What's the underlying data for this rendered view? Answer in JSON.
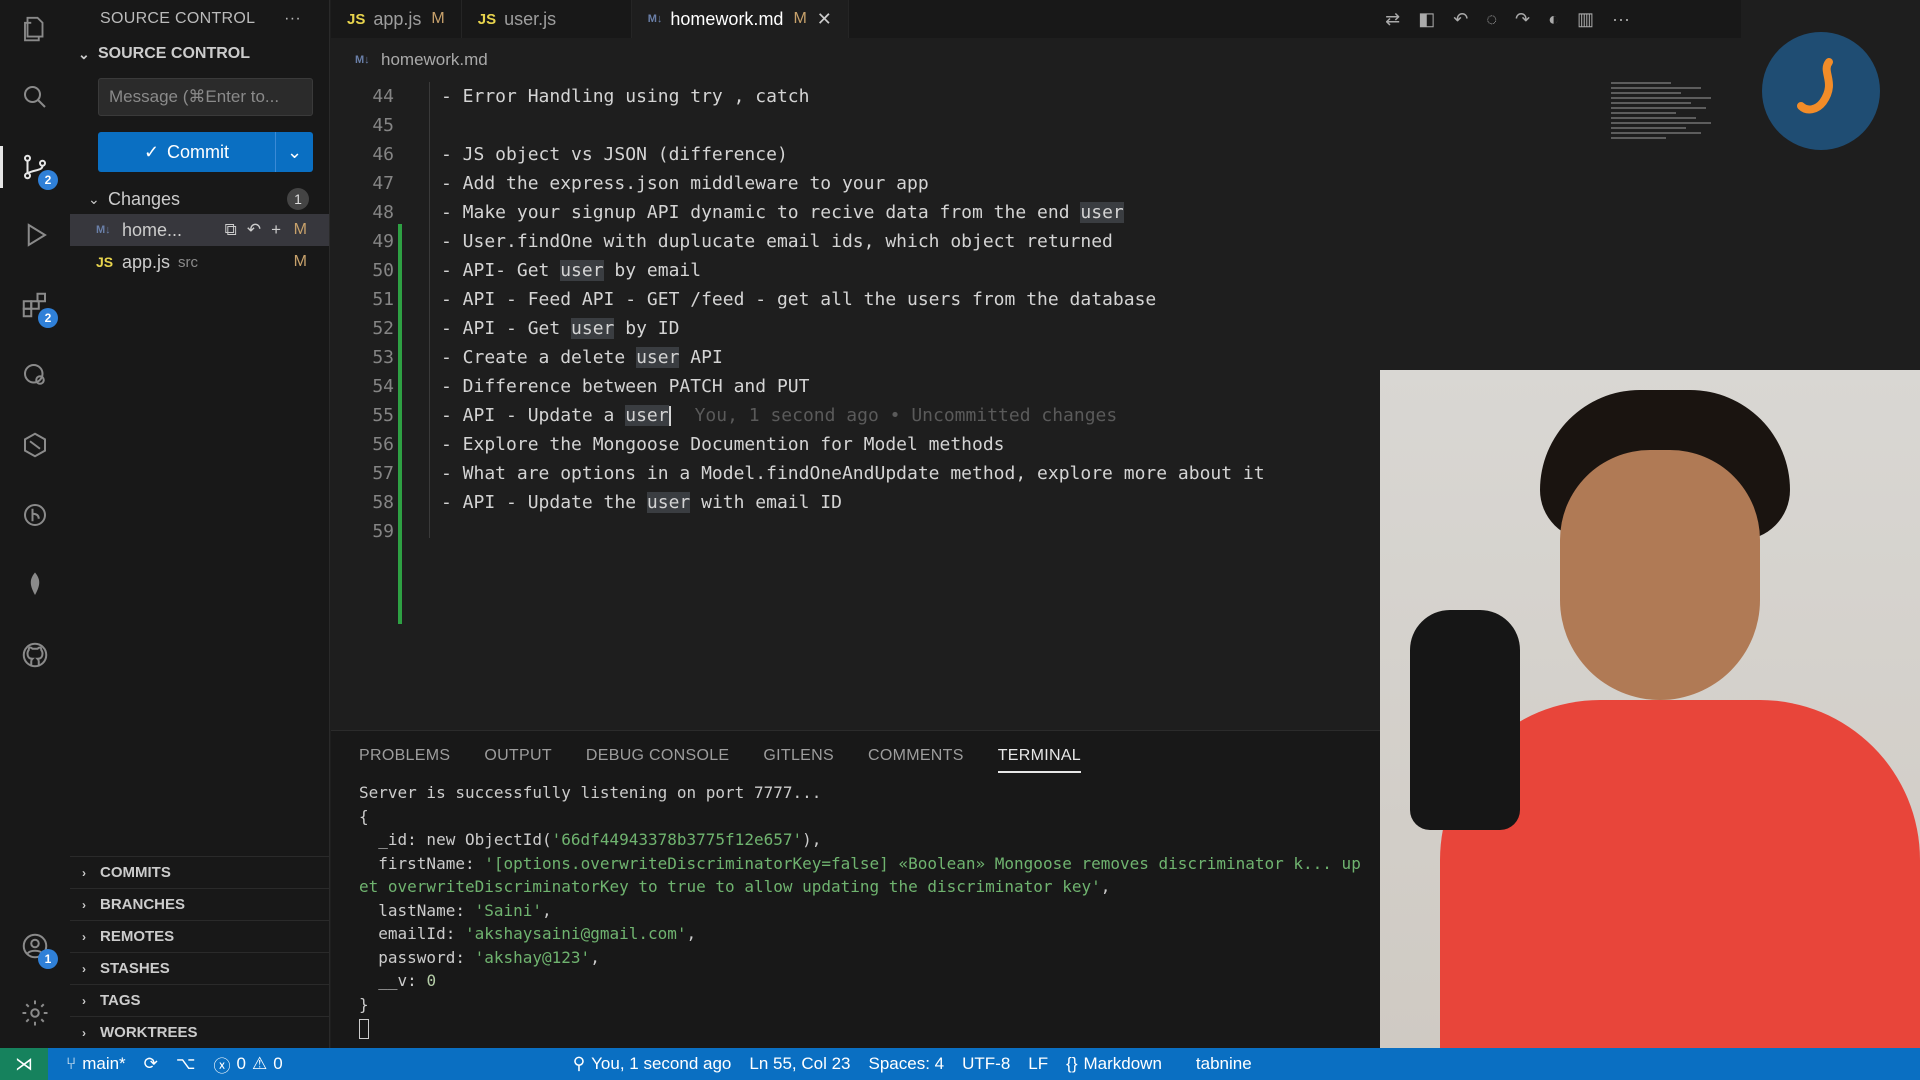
{
  "sidebar": {
    "title": "SOURCE CONTROL",
    "section": "SOURCE CONTROL",
    "message_placeholder": "Message (⌘Enter to...",
    "commit_label": "Commit",
    "changes_label": "Changes",
    "changes_count": "1",
    "files": [
      {
        "name": "home...",
        "dir": "",
        "status": "M"
      },
      {
        "name": "app.js",
        "dir": "src",
        "status": "M"
      }
    ],
    "collapsed": [
      "COMMITS",
      "BRANCHES",
      "REMOTES",
      "STASHES",
      "TAGS",
      "WORKTREES"
    ]
  },
  "activity": {
    "scm_badge": "2",
    "ext_badge": "2",
    "account_badge": "1"
  },
  "tabs": [
    {
      "icon": "JS",
      "label": "app.js",
      "status": "M"
    },
    {
      "icon": "JS",
      "label": "user.js",
      "status": ""
    },
    {
      "icon": "M↓",
      "label": "homework.md",
      "status": "M"
    }
  ],
  "breadcrumb": "homework.md",
  "editor": {
    "lines": [
      {
        "n": "44",
        "text": "- Error Handling using try , catch"
      },
      {
        "n": "45",
        "text": ""
      },
      {
        "n": "46",
        "text": "- JS object vs JSON (difference)"
      },
      {
        "n": "47",
        "text": "- Add the express.json middleware to your app"
      },
      {
        "n": "48",
        "pre": "- Make your signup API dynamic to recive data from the end ",
        "hl": "user",
        "post": ""
      },
      {
        "n": "49",
        "text": "- User.findOne with duplucate email ids, which object returned"
      },
      {
        "n": "50",
        "pre": "- API- Get ",
        "hl": "user",
        "post": " by email"
      },
      {
        "n": "51",
        "text": "- API - Feed API - GET /feed - get all the users from the database"
      },
      {
        "n": "52",
        "pre": "- API - Get ",
        "hl": "user",
        "post": " by ID"
      },
      {
        "n": "53",
        "pre": "- Create a delete ",
        "hl": "user",
        "post": " API"
      },
      {
        "n": "54",
        "text": "- Difference between PATCH and PUT"
      },
      {
        "n": "55",
        "pre": "- API - Update a ",
        "hl": "user",
        "post": ""
      },
      {
        "n": "56",
        "text": "- Explore the Mongoose Documention for Model methods"
      },
      {
        "n": "57",
        "text": "- What are options in a Model.findOneAndUpdate method, explore more about it"
      },
      {
        "n": "58",
        "pre": "- API - Update the ",
        "hl": "user",
        "post": " with email ID"
      },
      {
        "n": "59",
        "text": ""
      }
    ],
    "ghost_text": "You, 1 second ago • Uncommitted changes"
  },
  "panel": {
    "tabs": [
      "PROBLEMS",
      "OUTPUT",
      "DEBUG CONSOLE",
      "GITLENS",
      "COMMENTS",
      "TERMINAL"
    ],
    "active_tab": "TERMINAL",
    "terminal": {
      "l1": "Server is successfully listening on port 7777...",
      "l2": "{",
      "l3a": "  _id: new ObjectId(",
      "l3b": "'66df44943378b3775f12e657'",
      "l3c": "),",
      "l4a": "  firstName: ",
      "l4b": "'[options.overwriteDiscriminatorKey=false] «Boolean» Mongoose removes discriminator k... up",
      "l5": "et overwriteDiscriminatorKey to true to allow updating the discriminator key'",
      "l5c": ",",
      "l6a": "  lastName: ",
      "l6b": "'Saini'",
      "l6c": ",",
      "l7a": "  emailId: ",
      "l7b": "'akshaysaini@gmail.com'",
      "l7c": ",",
      "l8a": "  password: ",
      "l8b": "'akshay@123'",
      "l8c": ",",
      "l9a": "  __v: ",
      "l9b": "0",
      "l10": "}"
    }
  },
  "status": {
    "branch": "main*",
    "errors": "0",
    "warnings": "0",
    "blame": "You, 1 second ago",
    "position": "Ln 55, Col 23",
    "spaces": "Spaces: 4",
    "encoding": "UTF-8",
    "eol": "LF",
    "language": "Markdown",
    "tabnine": "tabnine"
  },
  "colors": {
    "accent": "#0a6fc2",
    "modified": "#c7a16b",
    "added_gutter": "#2ea043"
  }
}
